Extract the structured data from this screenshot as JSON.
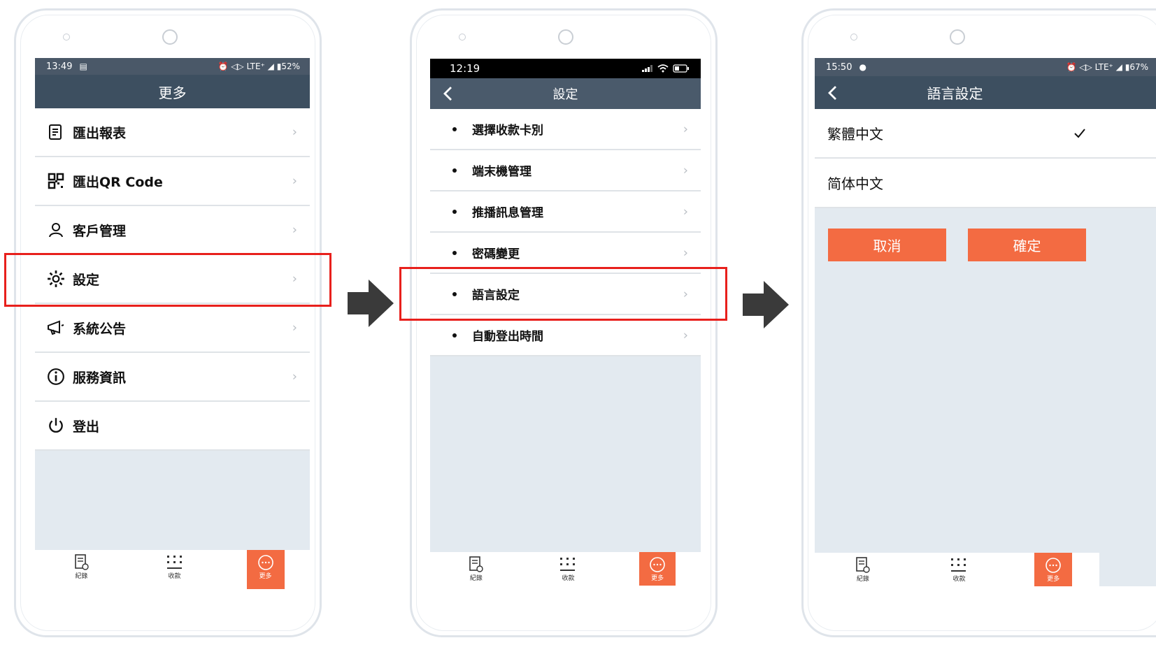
{
  "screen1": {
    "status_time": "13:49",
    "status_right": "⏰ ◁▷ LTE⁺ ◢ ▮52%",
    "header_title": "更多",
    "items": [
      {
        "label": "匯出報表",
        "icon": "report-icon"
      },
      {
        "label": "匯出QR Code",
        "icon": "qr-code-icon"
      },
      {
        "label": "客戶管理",
        "icon": "person-icon"
      },
      {
        "label": "設定",
        "icon": "gear-icon"
      },
      {
        "label": "系統公告",
        "icon": "megaphone-icon"
      },
      {
        "label": "服務資訊",
        "icon": "info-icon"
      },
      {
        "label": "登出",
        "icon": "power-icon"
      }
    ],
    "tabs": [
      {
        "label": "紀錄",
        "icon": "receipt-icon"
      },
      {
        "label": "收款",
        "icon": "keypad-icon"
      },
      {
        "label": "更多",
        "icon": "more-icon"
      }
    ]
  },
  "screen2": {
    "status_time": "12:19",
    "header_title": "設定",
    "items": [
      "選擇收款卡別",
      "端末機管理",
      "推播訊息管理",
      "密碼變更",
      "語言設定",
      "自動登出時間"
    ],
    "tabs": [
      {
        "label": "紀錄",
        "icon": "receipt-icon"
      },
      {
        "label": "收款",
        "icon": "keypad-icon"
      },
      {
        "label": "更多",
        "icon": "more-icon"
      }
    ]
  },
  "screen3": {
    "status_time": "15:50",
    "status_right": "⏰ ◁▷ LTE⁺ ◢ ▮67%",
    "header_title": "語言設定",
    "options": [
      "繁體中文",
      "简体中文"
    ],
    "selected": "繁體中文",
    "cancel_label": "取消",
    "confirm_label": "確定",
    "tabs": [
      {
        "label": "紀錄",
        "icon": "receipt-icon"
      },
      {
        "label": "收款",
        "icon": "keypad-icon"
      },
      {
        "label": "更多",
        "icon": "more-icon"
      }
    ]
  },
  "colors": {
    "header": "#3d4f60",
    "accent": "#f36b42",
    "highlight": "#e8201c",
    "screen_bg": "#e3eaf0"
  }
}
